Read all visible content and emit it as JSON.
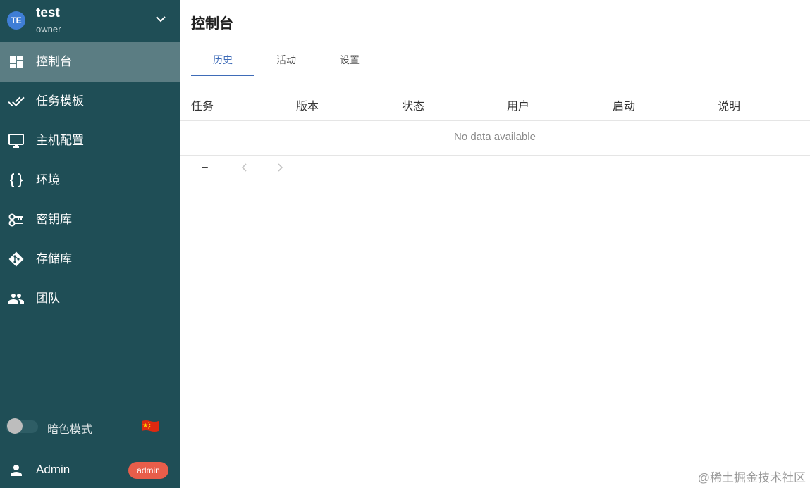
{
  "project": {
    "avatar": "TE",
    "name": "test",
    "role": "owner"
  },
  "nav": [
    {
      "label": "控制台",
      "icon": "dashboard-icon",
      "active": true
    },
    {
      "label": "任务模板",
      "icon": "done-all-icon"
    },
    {
      "label": "主机配置",
      "icon": "monitor-icon"
    },
    {
      "label": "环境",
      "icon": "code-braces-icon"
    },
    {
      "label": "密钥库",
      "icon": "key-icon"
    },
    {
      "label": "存储库",
      "icon": "git-icon"
    },
    {
      "label": "团队",
      "icon": "team-icon"
    }
  ],
  "dark_mode": {
    "label": "暗色模式",
    "enabled": false
  },
  "language": {
    "flag": "cn-flag-icon"
  },
  "user": {
    "name": "Admin",
    "badge": "admin"
  },
  "page": {
    "title": "控制台"
  },
  "tabs": [
    {
      "label": "历史",
      "active": true
    },
    {
      "label": "活动"
    },
    {
      "label": "设置"
    }
  ],
  "table": {
    "headers": [
      "任务",
      "版本",
      "状态",
      "用户",
      "启动",
      "说明"
    ],
    "empty": "No data available"
  },
  "pager": {
    "range": "–"
  },
  "watermark": "@稀土掘金技术社区",
  "colors": {
    "sidebar": "#1f4e56",
    "accent": "#3f6cb8",
    "badge": "#e85d4a"
  }
}
